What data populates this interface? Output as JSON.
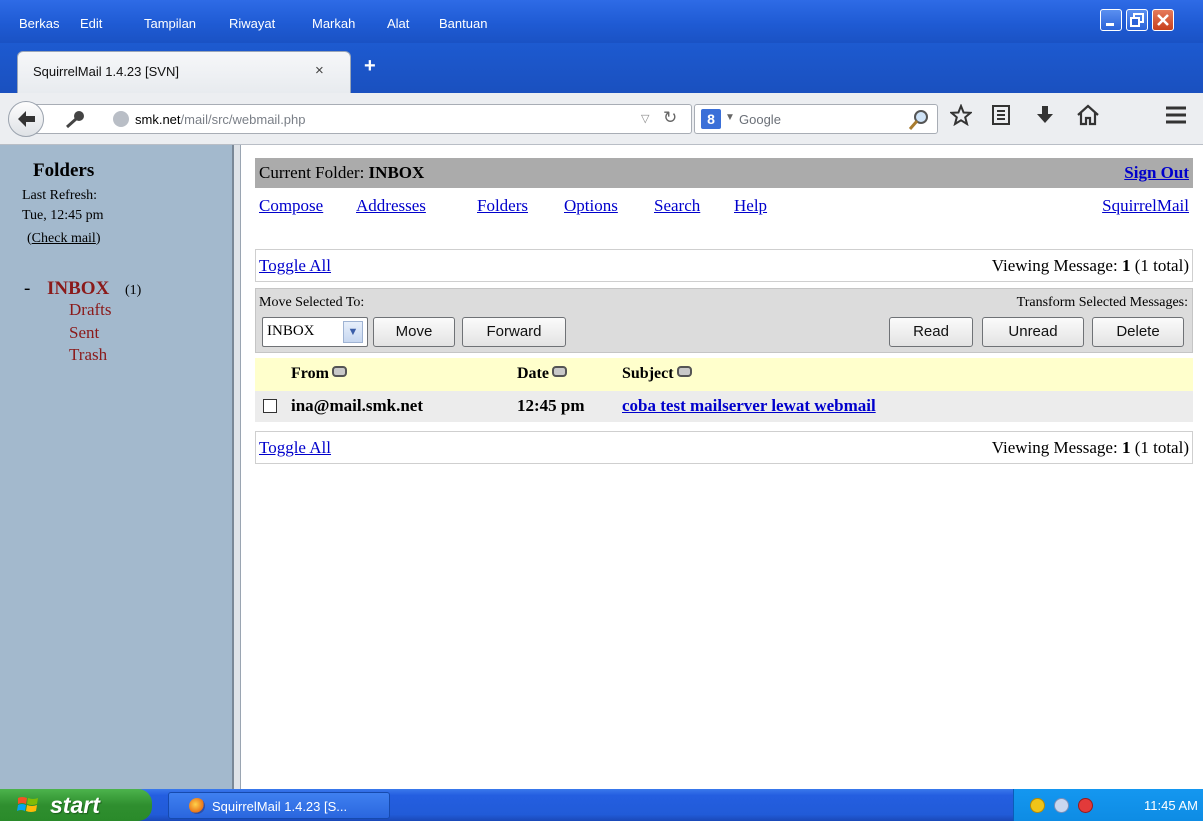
{
  "menubar": {
    "items": [
      "Berkas",
      "Edit",
      "Tampilan",
      "Riwayat",
      "Markah",
      "Alat",
      "Bantuan"
    ]
  },
  "browser": {
    "tab_title": "SquirrelMail 1.4.23 [SVN]",
    "tab_close": "×",
    "new_tab": "+",
    "url_host": "smk.net",
    "url_path": "/mail/src/webmail.php",
    "search_placeholder": "Google",
    "search_engine_letter": "8"
  },
  "sidebar": {
    "title": "Folders",
    "last_refresh_label": "Last Refresh:",
    "last_refresh_time": "Tue, 12:45 pm",
    "check_mail_open": "(",
    "check_mail": "Check mail",
    "check_mail_close": ")",
    "folder_prefix": "-",
    "inbox": {
      "label": "INBOX",
      "count": "(1)"
    },
    "folders": [
      "Drafts",
      "Sent",
      "Trash"
    ]
  },
  "main": {
    "current_folder_label": "Current Folder:",
    "current_folder": "INBOX",
    "sign_out": "Sign Out",
    "nav_links": [
      "Compose",
      "Addresses",
      "Folders",
      "Options",
      "Search",
      "Help"
    ],
    "brand_link": "SquirrelMail",
    "toggle_all": "Toggle All",
    "viewing_prefix": "Viewing Message:",
    "viewing_number": "1",
    "viewing_total": "(1 total)",
    "move_selected_label": "Move Selected To:",
    "transform_label": "Transform Selected Messages:",
    "folder_select_value": "INBOX",
    "buttons": {
      "move": "Move",
      "forward": "Forward",
      "read": "Read",
      "unread": "Unread",
      "delete": "Delete"
    },
    "columns": {
      "from": "From",
      "date": "Date",
      "subject": "Subject"
    },
    "messages": [
      {
        "from": "ina@mail.smk.net",
        "date": "12:45 pm",
        "subject": "coba test mailserver lewat webmail"
      }
    ]
  },
  "taskbar": {
    "start": "start",
    "task_label": "SquirrelMail 1.4.23 [S...",
    "clock": "11:45 AM"
  }
}
